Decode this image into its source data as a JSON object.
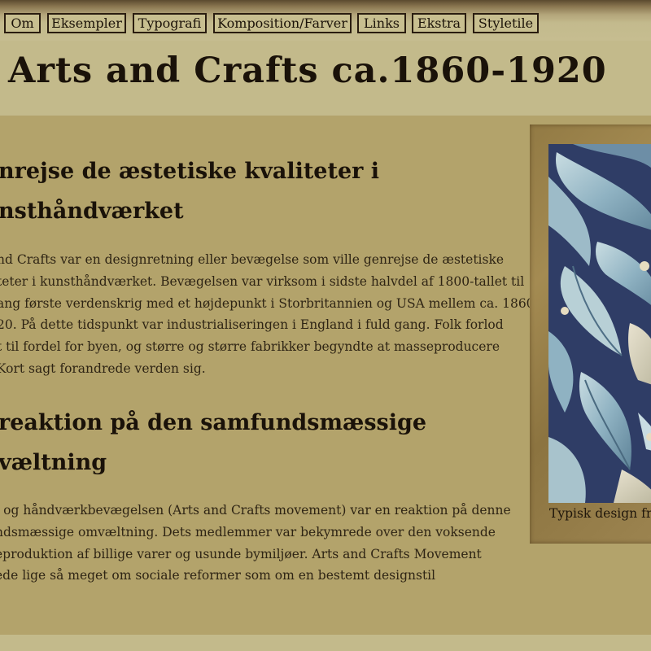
{
  "nav": {
    "items": [
      {
        "label": "Om"
      },
      {
        "label": "Eksempler"
      },
      {
        "label": "Typografi"
      },
      {
        "label": "Komposition/Farver"
      },
      {
        "label": "Links"
      },
      {
        "label": "Ekstra"
      },
      {
        "label": "Styletile"
      }
    ]
  },
  "page": {
    "title": "Arts and Crafts ca.1860-1920"
  },
  "sections": [
    {
      "heading_lines": [
        "nrejse de æstetiske kvaliteter i",
        "nsthåndværket"
      ],
      "paragraph_lines": [
        "nd Crafts var en designretning eller bevægelse som ville genrejse de æstetiske",
        "teter i kunsthåndværket. Bevægelsen var virksom i sidste halvdel af 1800-tallet til",
        "ang første verdenskrig med et højdepunkt i Storbritannien og USA mellem ca. 1860",
        "20. På dette tidspunkt var industrialiseringen i England i fuld gang. Folk forlod",
        "t til fordel for byen, og større og større fabrikker begyndte at masseproducere",
        " Kort sagt forandrede verden sig."
      ]
    },
    {
      "heading_lines": [
        " reaktion på den samfundsmæssige",
        "væltning"
      ],
      "paragraph_lines": [
        "- og håndværkbevægelsen (Arts and Crafts movement) var en reaktion på denne",
        "ndsmæssige omvæltning. Dets medlemmer var bekymrede over den voksende",
        "eproduktion af billige varer og usunde bymiljøer. Arts and Crafts Movement",
        "ede lige så meget om sociale reformer som om en bestemt designstil"
      ]
    }
  ],
  "figure": {
    "image_icon": "acanthus-leaf-pattern-image",
    "caption": "Typisk design fra"
  },
  "colors": {
    "page_background": "#bfb688",
    "content_background": "#b3a36b",
    "text_dark": "#1a1209",
    "button_border": "#2a1d10",
    "pattern_navy": "#2f3d66",
    "pattern_blue": "#8fb2c2"
  }
}
